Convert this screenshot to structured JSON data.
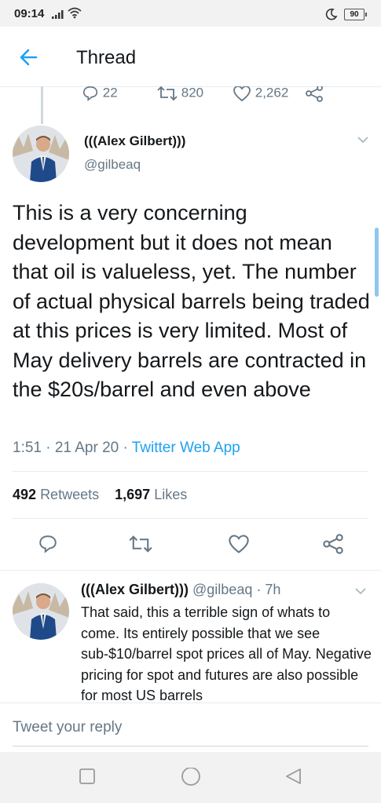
{
  "status_bar": {
    "time": "09:14",
    "battery": "90"
  },
  "header": {
    "title": "Thread"
  },
  "previous_tweet": {
    "reply_count": "22",
    "retweet_count": "820",
    "like_count": "2,262"
  },
  "main_tweet": {
    "author_name": "(((Alex Gilbert)))",
    "author_handle": "@gilbeaq",
    "text": "This is a very concerning development but it does not mean that oil is valueless, yet. The number of actual physical barrels being traded at this prices is very limited. Most of May delivery barrels are contracted in the $20s/barrel and even above",
    "time": "1:51 · 21 Apr 20 · ",
    "app": "Twitter Web App",
    "retweets_count": "492",
    "retweets_label": "Retweets",
    "likes_count": "1,697",
    "likes_label": "Likes"
  },
  "reply_tweet": {
    "author_name": "(((Alex Gilbert)))",
    "author_handle": "@gilbeaq",
    "age": "· 7h",
    "text": "That said, this a terrible sign of whats to come. Its entirely possible that we see sub-$10/barrel spot prices all of May. Negative pricing for spot and futures are also possible for most US barrels"
  },
  "compose": {
    "placeholder": "Tweet your reply"
  },
  "colors": {
    "accent": "#1da1f2",
    "secondary_text": "#657786",
    "divider": "#e6ecf0"
  }
}
